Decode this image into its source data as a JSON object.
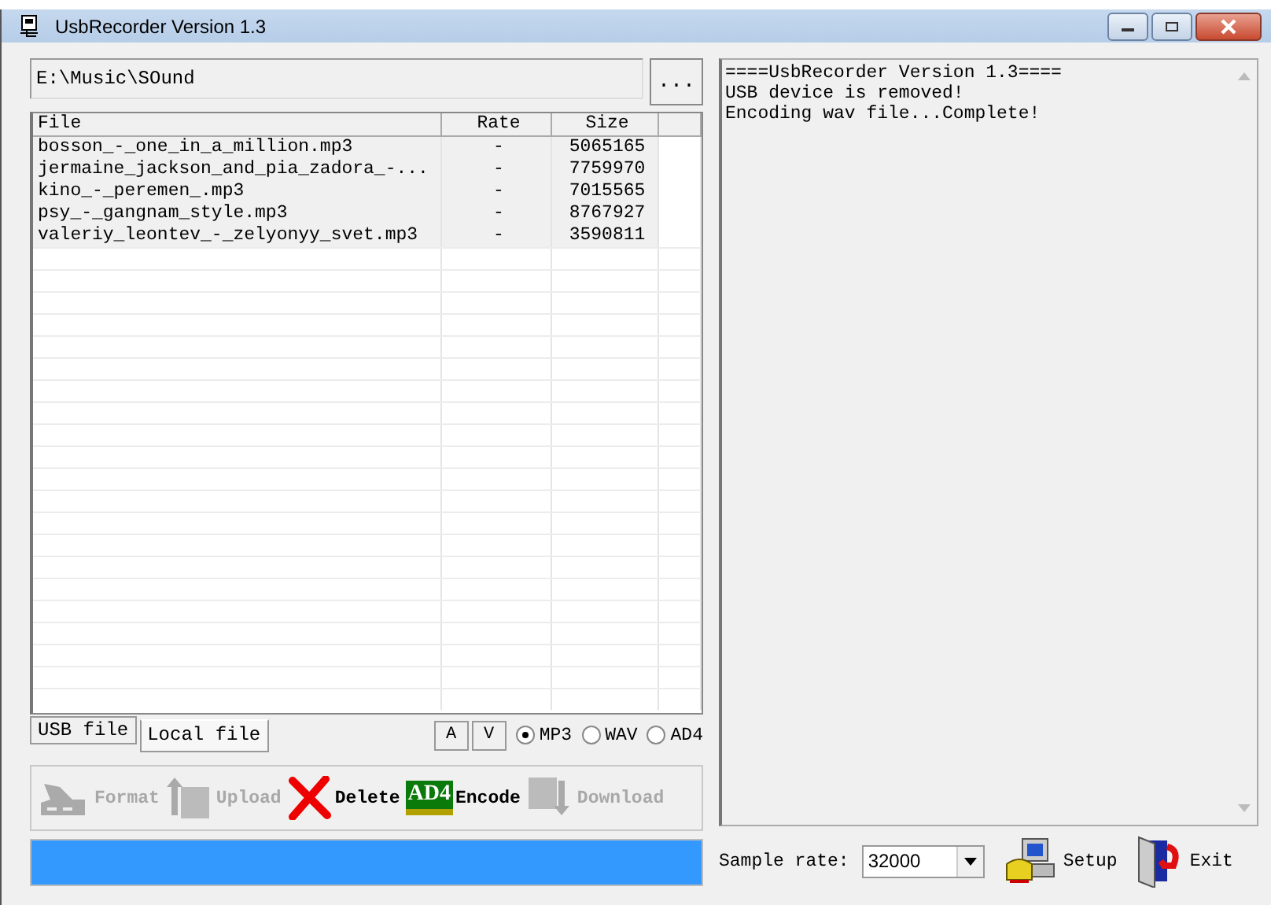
{
  "window": {
    "title": "UsbRecorder Version 1.3"
  },
  "path_field": {
    "value": "E:\\Music\\SOund"
  },
  "browse_button": "...",
  "table": {
    "columns": [
      "File",
      "Rate",
      "Size"
    ],
    "rows": [
      {
        "file": "bosson_-_one_in_a_million.mp3",
        "rate": "-",
        "size": "5065165"
      },
      {
        "file": "jermaine_jackson_and_pia_zadora_-...",
        "rate": "-",
        "size": "7759970"
      },
      {
        "file": "kino_-_peremen_.mp3",
        "rate": "-",
        "size": "7015565"
      },
      {
        "file": "psy_-_gangnam_style.mp3",
        "rate": "-",
        "size": "8767927"
      },
      {
        "file": "valeriy_leontev_-_zelyonyy_svet.mp3",
        "rate": "-",
        "size": "3590811"
      }
    ]
  },
  "tabs": [
    {
      "label": "USB file",
      "selected": false
    },
    {
      "label": "Local file",
      "selected": true
    }
  ],
  "sort_buttons": [
    "A",
    "V"
  ],
  "formats": [
    {
      "label": "MP3",
      "selected": true
    },
    {
      "label": "WAV",
      "selected": false
    },
    {
      "label": "AD4",
      "selected": false
    }
  ],
  "toolbar": [
    {
      "kind": "format",
      "label": "Format",
      "disabled": true
    },
    {
      "kind": "upload",
      "label": "Upload",
      "disabled": true
    },
    {
      "kind": "delete",
      "label": "Delete",
      "disabled": false
    },
    {
      "kind": "encode",
      "label": "Encode",
      "icon_text": "AD4",
      "disabled": false
    },
    {
      "kind": "download",
      "label": "Download",
      "disabled": true
    }
  ],
  "progress": {
    "level": 1
  },
  "log": [
    "====UsbRecorder Version 1.3====",
    "USB device is removed!",
    "Encoding wav file...Complete!"
  ],
  "sample_rate": {
    "label": "Sample rate:",
    "value": "32000"
  },
  "actions": [
    {
      "kind": "setup",
      "label": "Setup"
    },
    {
      "kind": "exit",
      "label": "Exit"
    }
  ]
}
